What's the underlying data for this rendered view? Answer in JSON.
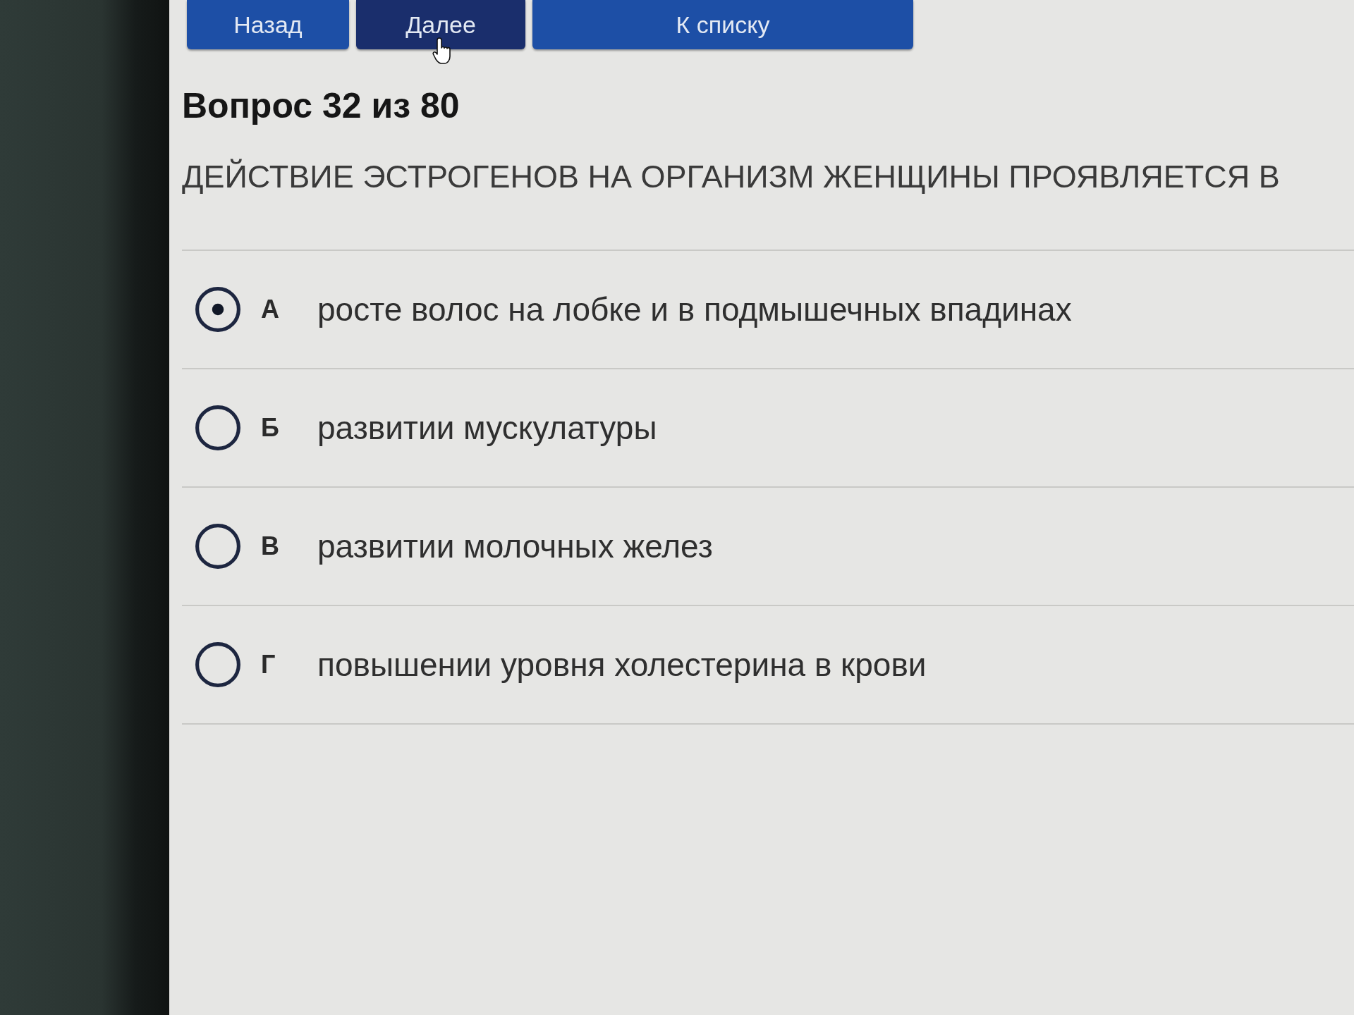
{
  "nav_buttons": [
    {
      "label": "Назад",
      "hovered": false
    },
    {
      "label": "Далее",
      "hovered": true
    },
    {
      "label": "К списку",
      "hovered": false
    }
  ],
  "question": {
    "heading": "Вопрос 32 из 80",
    "text": "ДЕЙСТВИЕ ЭСТРОГЕНОВ НА ОРГАНИЗМ ЖЕНЩИНЫ ПРОЯВЛЯЕТСЯ В"
  },
  "options": [
    {
      "letter": "А",
      "text": "росте волос на лобке и в подмышечных впадинах",
      "selected": true
    },
    {
      "letter": "Б",
      "text": "развитии мускулатуры",
      "selected": false
    },
    {
      "letter": "В",
      "text": "развитии молочных желез",
      "selected": false
    },
    {
      "letter": "Г",
      "text": "повышении уровня холестерина в крови",
      "selected": false
    }
  ]
}
